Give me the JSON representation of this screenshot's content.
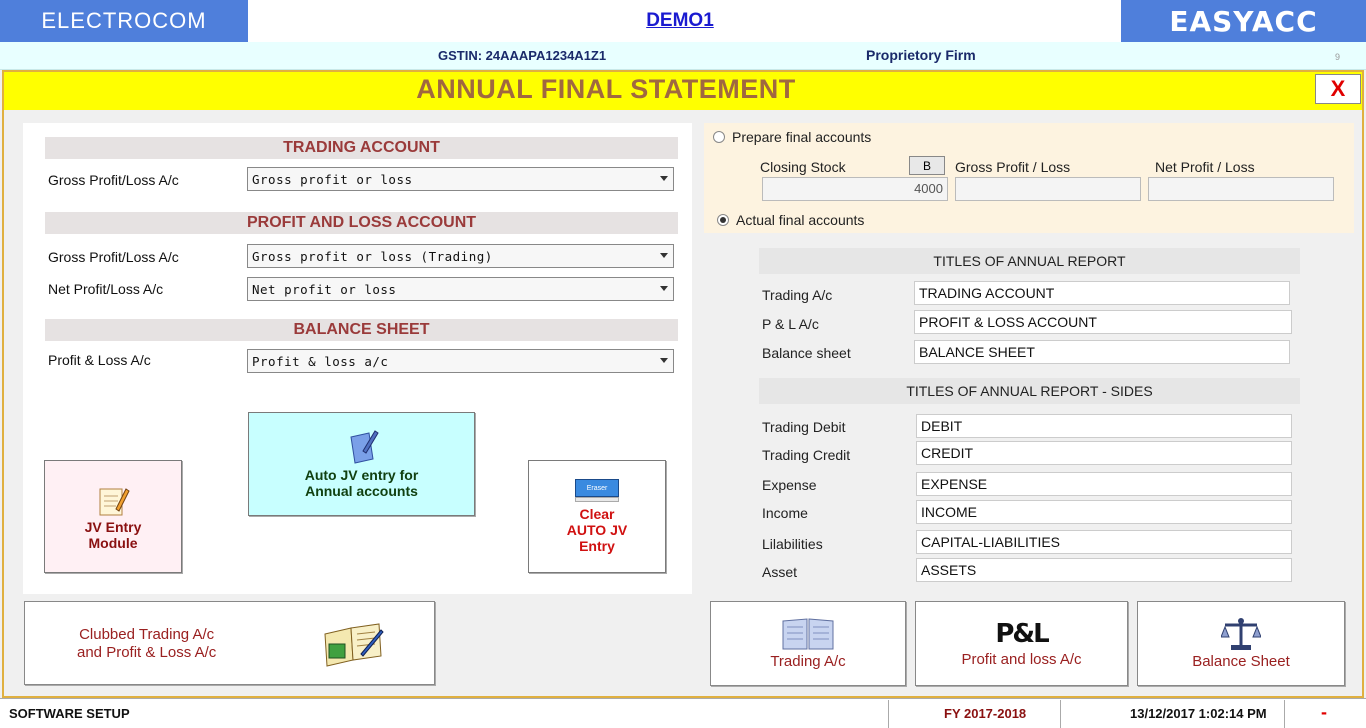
{
  "header": {
    "brand_left": "ELECTROCOM",
    "company": "DEMO1",
    "brand_right": "EASYACC",
    "gstin": "GSTIN: 24AAAPA1234A1Z1",
    "firm_type": "Proprietory Firm",
    "page_num": "9"
  },
  "window": {
    "title": "ANNUAL FINAL STATEMENT",
    "close_label": "X"
  },
  "left": {
    "trading": {
      "header": "TRADING ACCOUNT",
      "rows": [
        {
          "label": "Gross Profit/Loss A/c",
          "value": "Gross profit or loss"
        }
      ]
    },
    "pl": {
      "header": "PROFIT AND LOSS ACCOUNT",
      "rows": [
        {
          "label": "Gross Profit/Loss A/c",
          "value": "Gross profit or loss (Trading)"
        },
        {
          "label": "Net Profit/Loss A/c",
          "value": "Net profit or loss"
        }
      ]
    },
    "bs": {
      "header": "BALANCE SHEET",
      "rows": [
        {
          "label": "Profit & Loss A/c",
          "value": "Profit & loss a/c"
        }
      ]
    },
    "buttons": {
      "jv_entry_l1": "JV Entry",
      "jv_entry_l2": "Module",
      "auto_jv_l1": "Auto JV entry for",
      "auto_jv_l2": "Annual accounts",
      "clear_l1": "Clear",
      "clear_l2": "AUTO JV",
      "clear_l3": "Entry",
      "eraser_text": "Eraser"
    }
  },
  "right": {
    "prepare_label": "Prepare final accounts",
    "actual_label": "Actual final accounts",
    "closing_stock_label": "Closing Stock",
    "b_button": "B",
    "closing_stock_value": "4000",
    "gross_pl_label": "Gross Profit / Loss",
    "net_pl_label": "Net Profit / Loss",
    "gross_pl_value": "",
    "net_pl_value": "",
    "titles": {
      "header": "TITLES OF ANNUAL REPORT",
      "rows": [
        {
          "label": "Trading A/c",
          "value": "TRADING ACCOUNT"
        },
        {
          "label": "P & L A/c",
          "value": "PROFIT & LOSS ACCOUNT"
        },
        {
          "label": "Balance sheet",
          "value": "BALANCE SHEET"
        }
      ]
    },
    "sides": {
      "header": "TITLES OF ANNUAL REPORT - SIDES",
      "rows": [
        {
          "label": "Trading Debit",
          "value": "DEBIT"
        },
        {
          "label": "Trading Credit",
          "value": "CREDIT"
        },
        {
          "label": "Expense",
          "value": "EXPENSE"
        },
        {
          "label": "Income",
          "value": "INCOME"
        },
        {
          "label": "Lilabilities",
          "value": "CAPITAL-LIABILITIES"
        },
        {
          "label": "Asset",
          "value": "ASSETS"
        }
      ]
    }
  },
  "bottom": {
    "clubbed_l1": "Clubbed Trading A/c",
    "clubbed_l2": "and Profit & Loss A/c",
    "trading_btn": "Trading A/c",
    "pl_btn": "Profit and loss A/c",
    "bs_btn": "Balance Sheet",
    "pl_icon_text": "P&L"
  },
  "status": {
    "left": "SOFTWARE SETUP",
    "fy": "FY 2017-2018",
    "datetime": "13/12/2017 1:02:14 PM",
    "minimize": "-"
  },
  "colors": {
    "brand_blue": "#4f7fdb",
    "title_yellow": "#ffff00",
    "title_text": "#a06840",
    "section_text": "#9a3a3a"
  }
}
